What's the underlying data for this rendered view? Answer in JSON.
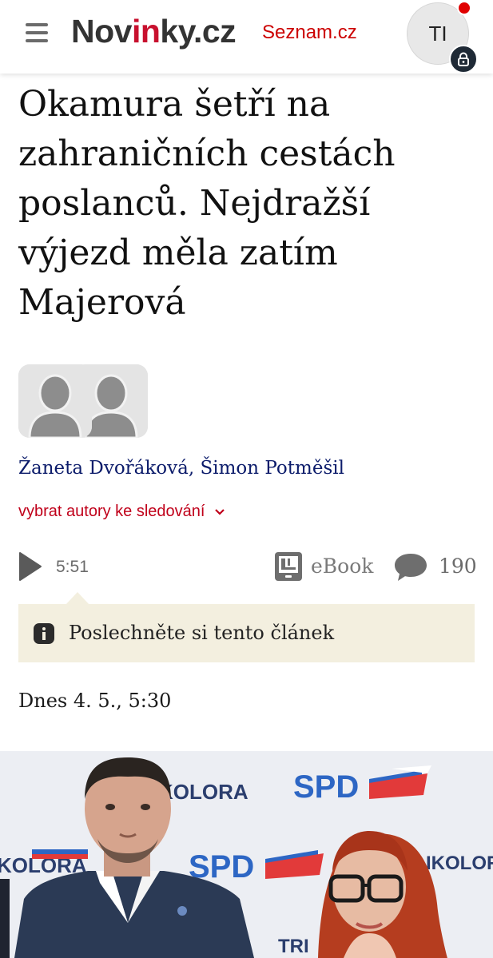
{
  "header": {
    "logo_pre": "Nov",
    "logo_in": "in",
    "logo_post": "ky.cz",
    "seznam_link": "Seznam.cz",
    "avatar_initials": "TI"
  },
  "article": {
    "title": "Okamura šetří na zahraničních cestách poslanců. Nejdražší výjezd měla zatím Majerová",
    "author_1": "Žaneta Dvořáková",
    "author_separator": ", ",
    "author_2": "Šimon Potměšil",
    "follow_label": "vybrat autory ke sledování",
    "audio_duration": "5:51",
    "ebook_label": "eBook",
    "comment_count": "190",
    "tooltip_text": "Poslechněte si tento článek",
    "published": "Dnes 4. 5., 5:30"
  },
  "photo": {
    "backdrop_texts": [
      "SPD",
      "SPD",
      "KOLORA",
      "KOLORA",
      "IKOLORA",
      "TRI"
    ]
  },
  "colors": {
    "brand_red": "#c8102e",
    "author_link": "#0c1c6b",
    "tooltip_bg": "#f3efdf",
    "spd_blue": "#2d66c4"
  }
}
